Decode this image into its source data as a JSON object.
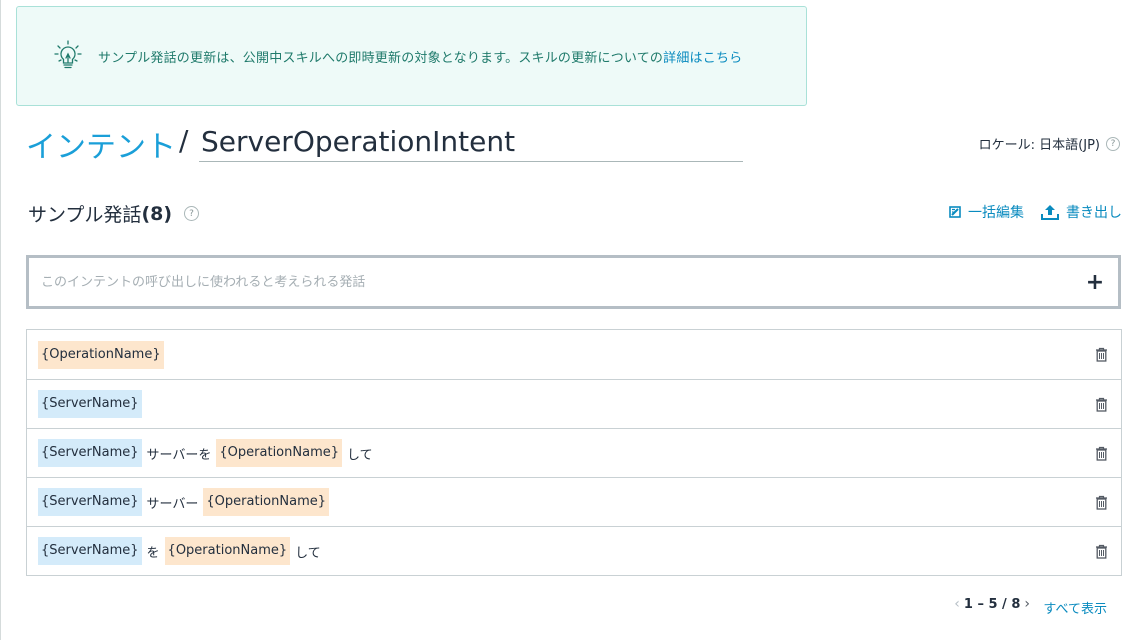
{
  "notice": {
    "icon": "lightbulb-icon",
    "text": "サンプル発話の更新は、公開中スキルへの即時更新の対象となります。スキルの更新についての",
    "link": "詳細はこちら"
  },
  "header": {
    "breadcrumb_link": "インテント",
    "separator": "/",
    "intent_name": "ServerOperationIntent",
    "locale_label": "ロケール: 日本語(JP)",
    "help": "?"
  },
  "section": {
    "title": "サンプル発話",
    "count": "(8)",
    "help": "?",
    "bulk_edit_label": "一括編集",
    "export_label": "書き出し"
  },
  "add_utterance": {
    "placeholder": "このインテントの呼び出しに使われると考えられる発話",
    "value": "",
    "add_symbol": "+"
  },
  "utterances": [
    [
      {
        "type": "slot",
        "color": "orange",
        "text": "{OperationName}"
      }
    ],
    [
      {
        "type": "slot",
        "color": "blue",
        "text": "{ServerName}"
      }
    ],
    [
      {
        "type": "slot",
        "color": "blue",
        "text": "{ServerName}"
      },
      {
        "type": "text",
        "text": "サーバーを"
      },
      {
        "type": "slot",
        "color": "orange",
        "text": "{OperationName}"
      },
      {
        "type": "text",
        "text": "して"
      }
    ],
    [
      {
        "type": "slot",
        "color": "blue",
        "text": "{ServerName}"
      },
      {
        "type": "text",
        "text": "サーバー"
      },
      {
        "type": "slot",
        "color": "orange",
        "text": "{OperationName}"
      }
    ],
    [
      {
        "type": "slot",
        "color": "blue",
        "text": "{ServerName}"
      },
      {
        "type": "text",
        "text": "を"
      },
      {
        "type": "slot",
        "color": "orange",
        "text": "{OperationName}"
      },
      {
        "type": "text",
        "text": "して"
      }
    ]
  ],
  "pagination": {
    "range": "1 – 5 / 8",
    "prev": "‹",
    "next": "›",
    "show_all": "すべて表示"
  },
  "colors": {
    "slot_blue": "#d4ebfa",
    "slot_orange": "#fde6cd",
    "link": "#0a8bbf",
    "title_link": "#1a9fd8",
    "notice_bg": "#eefaf8"
  }
}
